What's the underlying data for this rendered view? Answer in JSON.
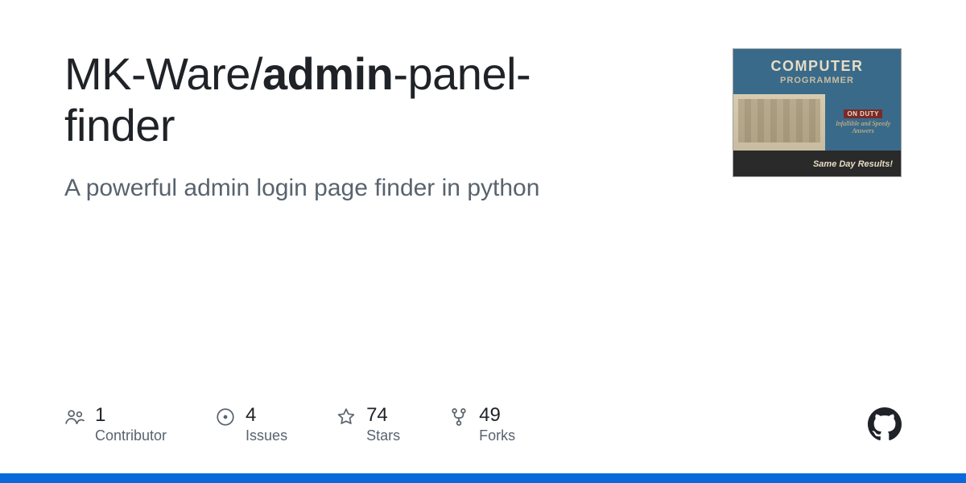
{
  "repo": {
    "owner": "MK-Ware",
    "sep": "/",
    "name_bold": "admin",
    "name_rest": "-panel-finder",
    "description": "A powerful admin login page finder in python"
  },
  "avatar": {
    "line1": "COMPUTER",
    "line2": "PROGRAMMER",
    "onduty": "ON DUTY",
    "script": "Infallible and Speedy Answers",
    "sameday": "Same Day Results!"
  },
  "stats": [
    {
      "icon": "people-icon",
      "count": "1",
      "label": "Contributor"
    },
    {
      "icon": "issue-icon",
      "count": "4",
      "label": "Issues"
    },
    {
      "icon": "star-icon",
      "count": "74",
      "label": "Stars"
    },
    {
      "icon": "fork-icon",
      "count": "49",
      "label": "Forks"
    }
  ]
}
